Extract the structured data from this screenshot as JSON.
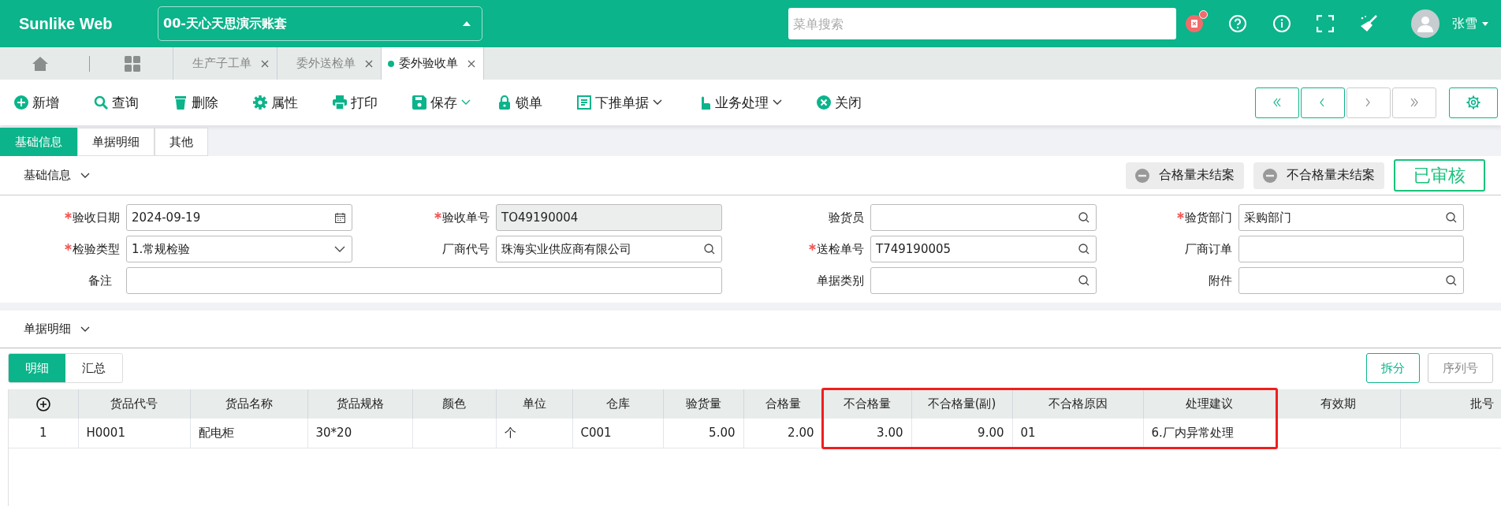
{
  "app": {
    "logo": "Sunlike Web",
    "account": "00-天心天思演示账套",
    "search": {
      "placeholder": "菜单搜索"
    },
    "notification": true,
    "user": "张雪"
  },
  "page_tabs": [
    {
      "label": "生产子工单",
      "selected": false
    },
    {
      "label": "委外送检单",
      "selected": false
    },
    {
      "label": "委外验收单",
      "selected": true
    }
  ],
  "toolbar": [
    {
      "label": "新增",
      "has_menu": false
    },
    {
      "label": "查询",
      "has_menu": false
    },
    {
      "label": "删除",
      "has_menu": false
    },
    {
      "label": "属性",
      "has_menu": false
    },
    {
      "label": "打印",
      "has_menu": false
    },
    {
      "label": "保存",
      "has_menu": true
    },
    {
      "label": "锁单",
      "has_menu": false
    },
    {
      "label": "下推单据",
      "has_menu": true
    },
    {
      "label": "业务处理",
      "has_menu": true
    },
    {
      "label": "关闭",
      "has_menu": false
    }
  ],
  "nav_buttons": [
    {
      "enabled": true
    },
    {
      "enabled": true
    },
    {
      "enabled": false
    },
    {
      "enabled": false
    }
  ],
  "form_tabs": [
    {
      "label": "基础信息",
      "selected": true
    },
    {
      "label": "单据明细",
      "selected": false
    },
    {
      "label": "其他",
      "selected": false
    }
  ],
  "basic_section": {
    "title": "基础信息",
    "badges": [
      "合格量未结案",
      "不合格量未结案"
    ],
    "stamp": "已审核",
    "fields": [
      {
        "label": "验收日期",
        "required": true,
        "kind": "date",
        "value": "2024-09-19"
      },
      {
        "label": "验收单号",
        "required": true,
        "kind": "readonly",
        "value": "TO49190004"
      },
      {
        "label": "验货员",
        "required": false,
        "kind": "search"
      },
      {
        "label": "验货部门",
        "required": true,
        "kind": "search",
        "value": "采购部门"
      },
      {
        "label": "检验类型",
        "required": true,
        "kind": "select",
        "value": "1.常规检验"
      },
      {
        "label": "厂商代号",
        "required": false,
        "kind": "search",
        "value": "珠海实业供应商有限公司"
      },
      {
        "label": "送检单号",
        "required": true,
        "kind": "search",
        "value": "T749190005"
      },
      {
        "label": "厂商订单",
        "required": false,
        "kind": "text"
      },
      {
        "label": "备注",
        "required": false,
        "kind": "wide"
      },
      {
        "label": "单据类别",
        "required": false,
        "kind": "search"
      },
      {
        "label": "附件",
        "required": false,
        "kind": "search"
      }
    ]
  },
  "detail_section": {
    "title": "单据明细",
    "tabs": [
      {
        "label": "明细",
        "selected": true
      },
      {
        "label": "汇总",
        "selected": false
      }
    ],
    "buttons": [
      {
        "label": "拆分",
        "enabled": true
      },
      {
        "label": "序列号",
        "enabled": false
      }
    ],
    "table": {
      "columns": [
        {
          "label": "货品代号",
          "highlighted": false
        },
        {
          "label": "货品名称",
          "highlighted": false
        },
        {
          "label": "货品规格",
          "highlighted": false
        },
        {
          "label": "颜色",
          "highlighted": false
        },
        {
          "label": "单位",
          "highlighted": false
        },
        {
          "label": "仓库",
          "highlighted": false
        },
        {
          "label": "验货量",
          "highlighted": false
        },
        {
          "label": "合格量",
          "highlighted": false
        },
        {
          "label": "不合格量",
          "highlighted": true
        },
        {
          "label": "不合格量(副)",
          "highlighted": true
        },
        {
          "label": "不合格原因",
          "highlighted": true
        },
        {
          "label": "处理建议",
          "highlighted": true
        },
        {
          "label": "有效期",
          "highlighted": false
        },
        {
          "label": "批号",
          "highlighted": false
        }
      ],
      "rows": [
        {
          "index": "1",
          "cells": [
            "H0001",
            "配电柜",
            "30*20",
            "",
            "个",
            "C001",
            "5.00",
            "2.00",
            "3.00",
            "9.00",
            "01",
            "6.厂内异常处理",
            "",
            ""
          ]
        }
      ]
    }
  }
}
